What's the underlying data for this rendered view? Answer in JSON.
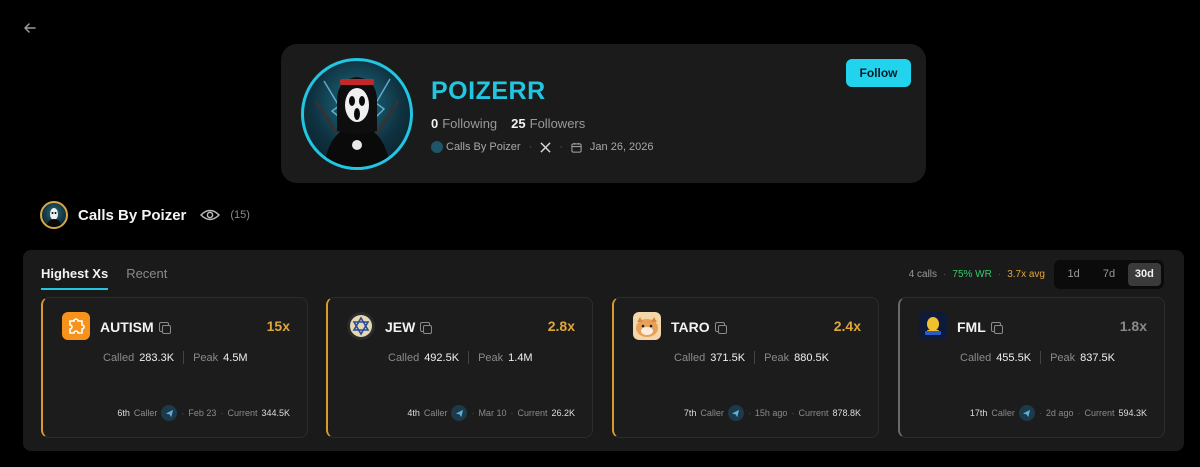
{
  "profile": {
    "username": "POIZERR",
    "following_count": "0",
    "following_label": "Following",
    "followers_count": "25",
    "followers_label": "Followers",
    "group_link": "Calls By Poizer",
    "joined": "Jan 26, 2026",
    "follow_label": "Follow"
  },
  "group": {
    "name": "Calls By Poizer",
    "count": "(15)"
  },
  "panel": {
    "tabs": [
      {
        "label": "Highest Xs",
        "active": true
      },
      {
        "label": "Recent",
        "active": false
      }
    ],
    "summary": {
      "calls": "4 calls",
      "winrate": "75% WR",
      "avg": "3.7x avg"
    },
    "ranges": [
      {
        "label": "1d",
        "selected": false
      },
      {
        "label": "7d",
        "selected": false
      },
      {
        "label": "30d",
        "selected": true
      }
    ]
  },
  "cards": [
    {
      "name": "AUTISM",
      "multiplier": "15x",
      "mult_color": "#e0a63a",
      "called_label": "Called",
      "called": "283.3K",
      "peak_label": "Peak",
      "peak": "4.5M",
      "caller": "6th",
      "caller_label": "Caller",
      "date": "Feb 23",
      "current_label": "Current",
      "current": "344.5K",
      "icon": "puzzle-icon"
    },
    {
      "name": "JEW",
      "multiplier": "2.8x",
      "mult_color": "#e0a63a",
      "called_label": "Called",
      "called": "492.5K",
      "peak_label": "Peak",
      "peak": "1.4M",
      "caller": "4th",
      "caller_label": "Caller",
      "date": "Mar 10",
      "current_label": "Current",
      "current": "26.2K",
      "icon": "star-of-david-icon"
    },
    {
      "name": "TARO",
      "multiplier": "2.4x",
      "mult_color": "#e0a63a",
      "called_label": "Called",
      "called": "371.5K",
      "peak_label": "Peak",
      "peak": "880.5K",
      "caller": "7th",
      "caller_label": "Caller",
      "date": "15h ago",
      "current_label": "Current",
      "current": "878.8K",
      "icon": "dog-icon"
    },
    {
      "name": "FML",
      "multiplier": "1.8x",
      "mult_color": "#8a8a8a",
      "called_label": "Called",
      "called": "455.5K",
      "peak_label": "Peak",
      "peak": "837.5K",
      "caller": "17th",
      "caller_label": "Caller",
      "date": "2d ago",
      "current_label": "Current",
      "current": "594.3K",
      "icon": "fml-icon"
    }
  ]
}
